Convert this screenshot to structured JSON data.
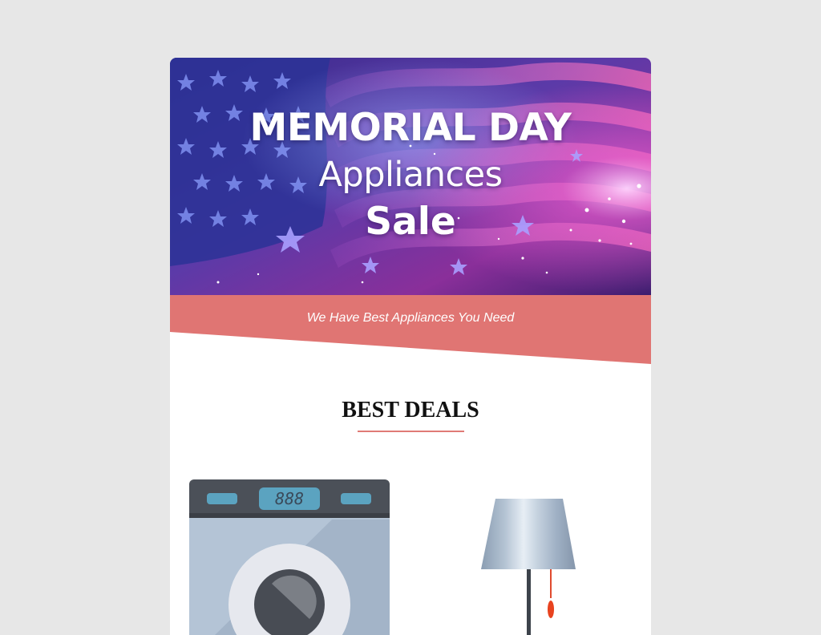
{
  "hero": {
    "line1": "MEMORIAL DAY",
    "line2": "Appliances",
    "line3": "Sale",
    "colors": {
      "flag_blue": "#2a2f8f",
      "flag_pink": "#c2338f",
      "glow": "#f6a8ff"
    }
  },
  "banner": {
    "tagline": "We Have Best Appliances You Need",
    "color": "#e07573"
  },
  "deals": {
    "heading": "BEST DEALS",
    "accent_color": "#e07a76"
  },
  "products": [
    {
      "name": "washing machine",
      "icon": "washing-machine-icon",
      "display_text": "888"
    },
    {
      "name": "floor lamp",
      "icon": "floor-lamp-icon"
    }
  ]
}
